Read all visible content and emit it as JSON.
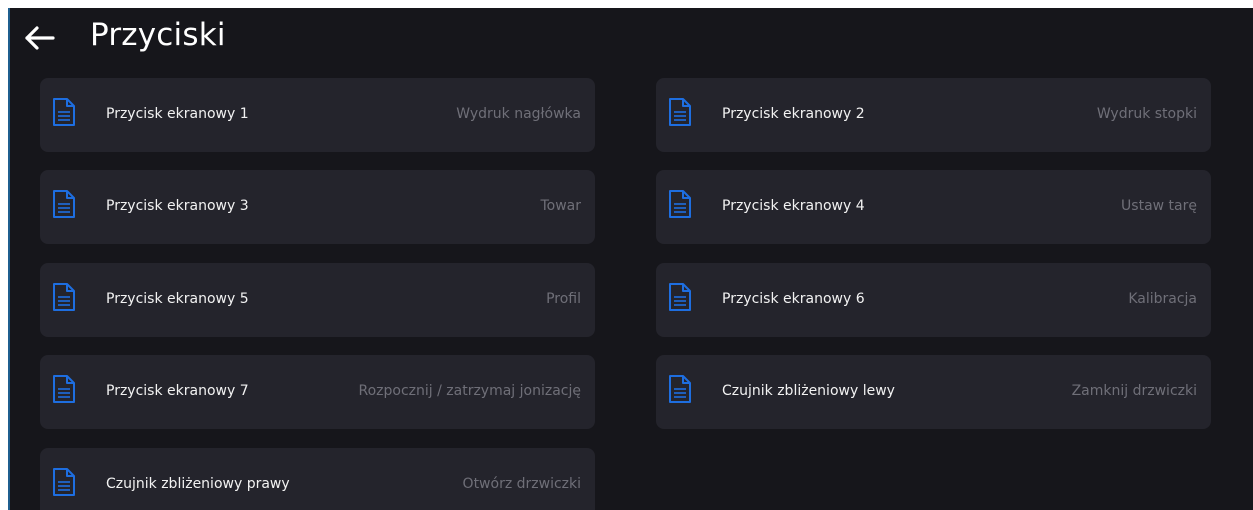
{
  "header": {
    "title": "Przyciski",
    "back_icon": "arrow-left-icon"
  },
  "colors": {
    "background": "#16161b",
    "card": "#24242c",
    "icon_accent": "#1e6ee0",
    "label": "#f2f2f2",
    "value": "#6f6f78"
  },
  "items": [
    {
      "label": "Przycisk ekranowy 1",
      "value": "Wydruk nagłówka",
      "icon": "document-icon"
    },
    {
      "label": "Przycisk ekranowy 2",
      "value": "Wydruk stopki",
      "icon": "document-icon"
    },
    {
      "label": "Przycisk ekranowy 3",
      "value": "Towar",
      "icon": "document-icon"
    },
    {
      "label": "Przycisk ekranowy 4",
      "value": "Ustaw tarę",
      "icon": "document-icon"
    },
    {
      "label": "Przycisk ekranowy 5",
      "value": "Profil",
      "icon": "document-icon"
    },
    {
      "label": "Przycisk ekranowy 6",
      "value": "Kalibracja",
      "icon": "document-icon"
    },
    {
      "label": "Przycisk ekranowy 7",
      "value": "Rozpocznij / zatrzymaj jonizację",
      "icon": "document-icon"
    },
    {
      "label": "Czujnik zbliżeniowy lewy",
      "value": "Zamknij drzwiczki",
      "icon": "document-icon"
    },
    {
      "label": "Czujnik zbliżeniowy prawy",
      "value": "Otwórz drzwiczki",
      "icon": "document-icon"
    }
  ]
}
